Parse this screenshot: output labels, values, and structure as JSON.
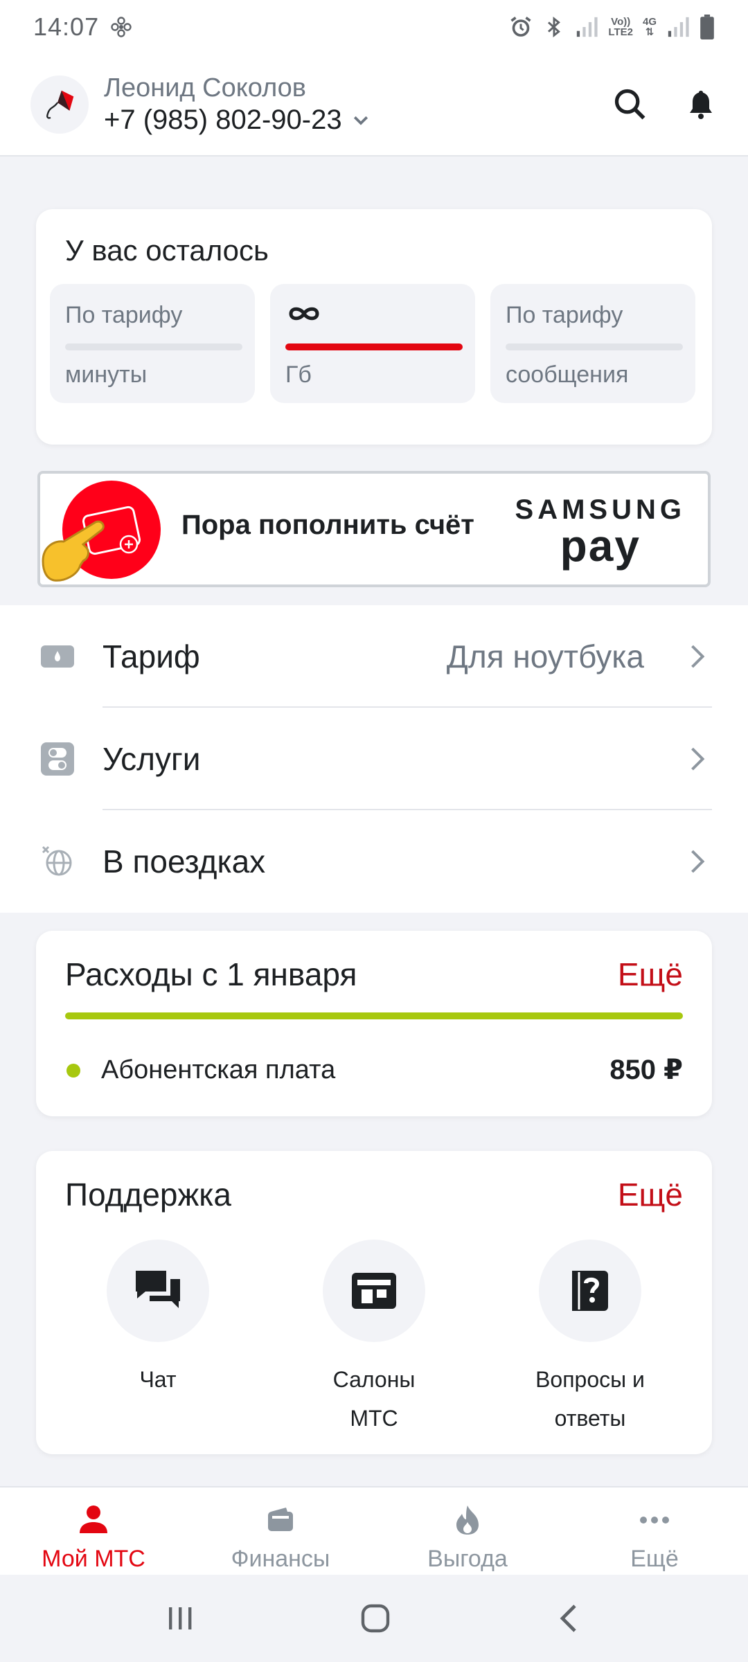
{
  "status_bar": {
    "time": "14:07",
    "volte": "Vo))",
    "lte": "LTE2",
    "network": "4G"
  },
  "header": {
    "user_name": "Леонид Соколов",
    "phone": "+7 (985) 802-90-23"
  },
  "remaining": {
    "title": "У вас осталось",
    "tiles": [
      {
        "top": "По тарифу",
        "bottom": "минуты"
      },
      {
        "top": "∞",
        "bottom": "Гб"
      },
      {
        "top": "По тарифу",
        "bottom": "сообщения"
      }
    ]
  },
  "banner": {
    "text": "Пора пополнить счёт",
    "brand_top": "SAMSUNG",
    "brand_bottom": "pay"
  },
  "menu": [
    {
      "label": "Тариф",
      "value": "Для ноутбука"
    },
    {
      "label": "Услуги",
      "value": ""
    },
    {
      "label": "В поездках",
      "value": ""
    }
  ],
  "expenses": {
    "title": "Расходы с 1 января",
    "more": "Ещё",
    "item_label": "Абонентская плата",
    "item_amount": "850 ₽"
  },
  "support": {
    "title": "Поддержка",
    "more": "Ещё",
    "items": [
      {
        "label_line1": "Чат",
        "label_line2": ""
      },
      {
        "label_line1": "Салоны",
        "label_line2": "МТС"
      },
      {
        "label_line1": "Вопросы и",
        "label_line2": "ответы"
      }
    ]
  },
  "tabs": [
    {
      "label": "Мой МТС",
      "active": true
    },
    {
      "label": "Финансы"
    },
    {
      "label": "Выгода"
    },
    {
      "label": "Ещё"
    }
  ],
  "colors": {
    "accent": "#e30611",
    "link": "#c30e17",
    "expense": "#a7c80f",
    "muted": "#6e7782"
  }
}
